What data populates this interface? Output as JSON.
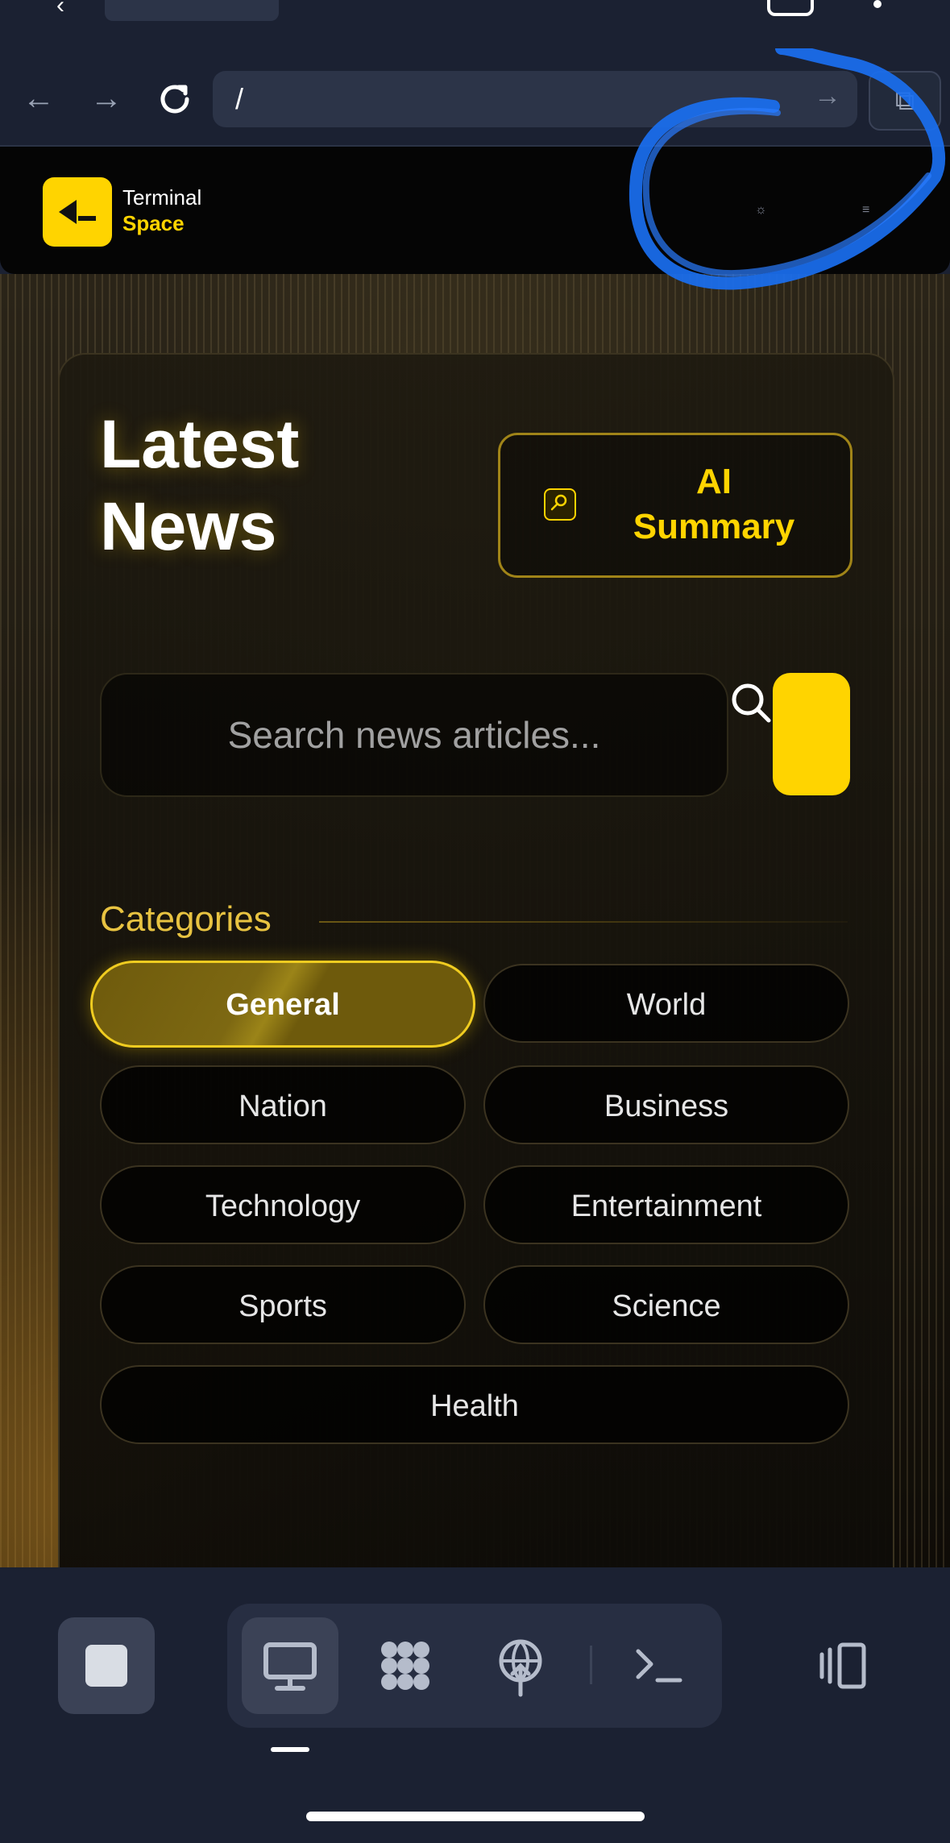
{
  "browser": {
    "url": "/"
  },
  "site": {
    "brand_line1": "Terminal",
    "brand_line2": "Space",
    "header_icon_1": "☼",
    "header_icon_2": "≡"
  },
  "main": {
    "title_line1": "Latest",
    "title_line2": "News",
    "ai_button_line1": "AI",
    "ai_button_line2": "Summary",
    "search_placeholder": "Search news articles...",
    "categories_label": "Categories",
    "categories": [
      {
        "label": "General",
        "active": true
      },
      {
        "label": "World",
        "active": false
      },
      {
        "label": "Nation",
        "active": false
      },
      {
        "label": "Business",
        "active": false
      },
      {
        "label": "Technology",
        "active": false
      },
      {
        "label": "Entertainment",
        "active": false
      },
      {
        "label": "Sports",
        "active": false
      },
      {
        "label": "Science",
        "active": false
      },
      {
        "label": "Health",
        "active": false
      }
    ]
  },
  "colors": {
    "accent": "#ffd400",
    "chrome_bg": "#1b2132",
    "annotation": "#1a6ff0"
  }
}
